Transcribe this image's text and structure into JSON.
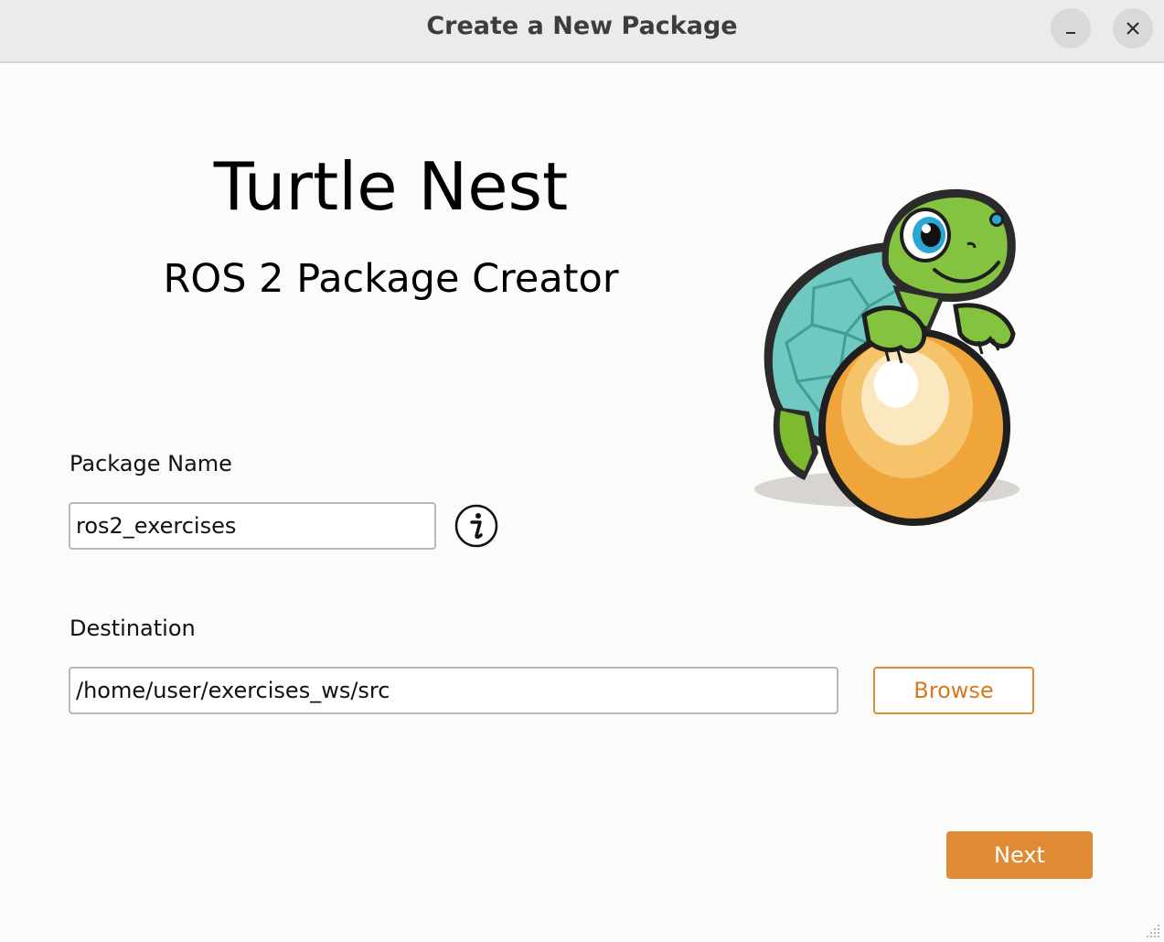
{
  "window": {
    "title": "Create a New Package",
    "controls": {
      "minimize_icon": "minimize-icon",
      "close_icon": "close-icon"
    }
  },
  "header": {
    "app_title": "Turtle Nest",
    "app_subtitle": "ROS 2 Package Creator",
    "mascot_icon": "turtle-hatching-egg-logo"
  },
  "form": {
    "package_name": {
      "label": "Package Name",
      "value": "ros2_exercises",
      "info_icon": "info-icon"
    },
    "destination": {
      "label": "Destination",
      "value": "/home/user/exercises_ws/src",
      "browse_label": "Browse"
    }
  },
  "footer": {
    "next_label": "Next"
  },
  "colors": {
    "accent": "#e08a35",
    "titlebar": "#ebebeb",
    "background": "#fbfbf9"
  }
}
